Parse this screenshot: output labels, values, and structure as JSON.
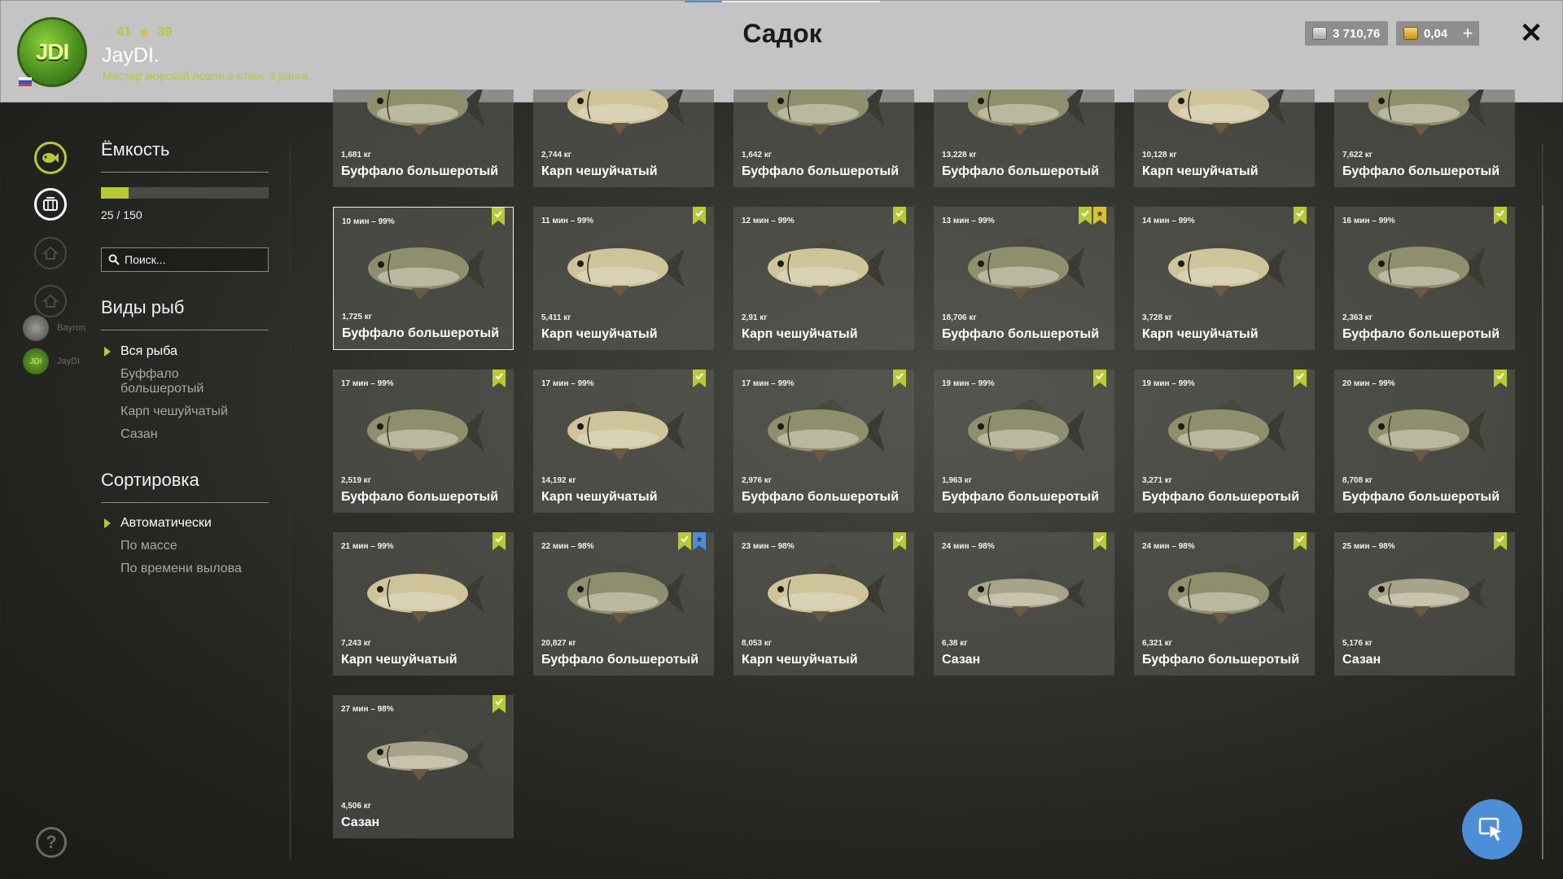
{
  "header": {
    "logo_text": "JDI",
    "stat_level": "41",
    "stat_stars": "39",
    "username": "JayDI.",
    "rank": "Мастер морской ловли в отвес 3 ранга",
    "title": "Садок",
    "silver": "3 710,76",
    "gold": "0,04",
    "plus_label": "+",
    "close_label": "✕"
  },
  "friends": [
    {
      "name": "Bayron"
    },
    {
      "name": "JayDI",
      "avatar_text": "JDI"
    }
  ],
  "panel": {
    "capacity_title": "Ёмкость",
    "capacity_text": "25 / 150",
    "capacity_fraction": 0.1667,
    "search_placeholder": "Поиск...",
    "species_title": "Виды рыб",
    "species": [
      "Вся рыба",
      "Буффало большеротый",
      "Карп чешуйчатый",
      "Сазан"
    ],
    "sort_title": "Сортировка",
    "sort_options": [
      "Автоматически",
      "По массе",
      "По времени вылова"
    ]
  },
  "help_label": "?",
  "fish": [
    {
      "time": "",
      "weight": "1,681 кг",
      "name": "Буффало большеротый",
      "kind": "buffalo",
      "badges": []
    },
    {
      "time": "",
      "weight": "2,744 кг",
      "name": "Карп чешуйчатый",
      "kind": "carp",
      "badges": []
    },
    {
      "time": "",
      "weight": "1,642 кг",
      "name": "Буффало большеротый",
      "kind": "buffalo",
      "badges": []
    },
    {
      "time": "",
      "weight": "13,228 кг",
      "name": "Буффало большеротый",
      "kind": "buffalo",
      "badges": []
    },
    {
      "time": "",
      "weight": "10,128 кг",
      "name": "Карп чешуйчатый",
      "kind": "carp",
      "badges": []
    },
    {
      "time": "",
      "weight": "7,622 кг",
      "name": "Буффало большеротый",
      "kind": "buffalo",
      "badges": []
    },
    {
      "time": "10 мин – 99%",
      "weight": "1,725 кг",
      "name": "Буффало большеротый",
      "kind": "buffalo",
      "badges": [
        "green"
      ],
      "selected": true
    },
    {
      "time": "11 мин – 99%",
      "weight": "5,411 кг",
      "name": "Карп чешуйчатый",
      "kind": "carp",
      "badges": [
        "green"
      ]
    },
    {
      "time": "12 мин – 99%",
      "weight": "2,91 кг",
      "name": "Карп чешуйчатый",
      "kind": "carp",
      "badges": [
        "green"
      ]
    },
    {
      "time": "13 мин – 99%",
      "weight": "18,706 кг",
      "name": "Буффало большеротый",
      "kind": "buffalo",
      "badges": [
        "green",
        "gold"
      ]
    },
    {
      "time": "14 мин – 99%",
      "weight": "3,728 кг",
      "name": "Карп чешуйчатый",
      "kind": "carp",
      "badges": [
        "green"
      ]
    },
    {
      "time": "16 мин – 99%",
      "weight": "2,363 кг",
      "name": "Буффало большеротый",
      "kind": "buffalo",
      "badges": [
        "green"
      ]
    },
    {
      "time": "17 мин – 99%",
      "weight": "2,519 кг",
      "name": "Буффало большеротый",
      "kind": "buffalo",
      "badges": [
        "green"
      ]
    },
    {
      "time": "17 мин – 99%",
      "weight": "14,192 кг",
      "name": "Карп чешуйчатый",
      "kind": "carp",
      "badges": [
        "green"
      ]
    },
    {
      "time": "17 мин – 99%",
      "weight": "2,976 кг",
      "name": "Буффало большеротый",
      "kind": "buffalo",
      "badges": [
        "green"
      ]
    },
    {
      "time": "19 мин – 99%",
      "weight": "1,963 кг",
      "name": "Буффало большеротый",
      "kind": "buffalo",
      "badges": [
        "green"
      ]
    },
    {
      "time": "19 мин – 99%",
      "weight": "3,271 кг",
      "name": "Буффало большеротый",
      "kind": "buffalo",
      "badges": [
        "green"
      ]
    },
    {
      "time": "20 мин – 99%",
      "weight": "8,708 кг",
      "name": "Буффало большеротый",
      "kind": "buffalo",
      "badges": [
        "green"
      ]
    },
    {
      "time": "21 мин – 99%",
      "weight": "7,243 кг",
      "name": "Карп чешуйчатый",
      "kind": "carp",
      "badges": [
        "green"
      ]
    },
    {
      "time": "22 мин – 98%",
      "weight": "20,827 кг",
      "name": "Буффало большеротый",
      "kind": "buffalo",
      "badges": [
        "green",
        "blue"
      ]
    },
    {
      "time": "23 мин – 98%",
      "weight": "8,053 кг",
      "name": "Карп чешуйчатый",
      "kind": "carp",
      "badges": [
        "green"
      ]
    },
    {
      "time": "24 мин – 98%",
      "weight": "6,38 кг",
      "name": "Сазан",
      "kind": "sazan",
      "badges": [
        "green"
      ]
    },
    {
      "time": "24 мин – 98%",
      "weight": "6,321 кг",
      "name": "Буффало большеротый",
      "kind": "buffalo",
      "badges": [
        "green"
      ]
    },
    {
      "time": "25 мин – 98%",
      "weight": "5,176 кг",
      "name": "Сазан",
      "kind": "sazan",
      "badges": [
        "green"
      ]
    },
    {
      "time": "27 мин – 98%",
      "weight": "4,506 кг",
      "name": "Сазан",
      "kind": "sazan",
      "badges": [
        "green"
      ]
    }
  ],
  "colors": {
    "accent": "#b8c934",
    "badge_green": "#b8c934",
    "badge_gold": "#d8c030",
    "badge_blue": "#4d8fd6",
    "buffalo": "#8f8f6e",
    "carp": "#cfc39a",
    "sazan": "#a8a48a"
  }
}
